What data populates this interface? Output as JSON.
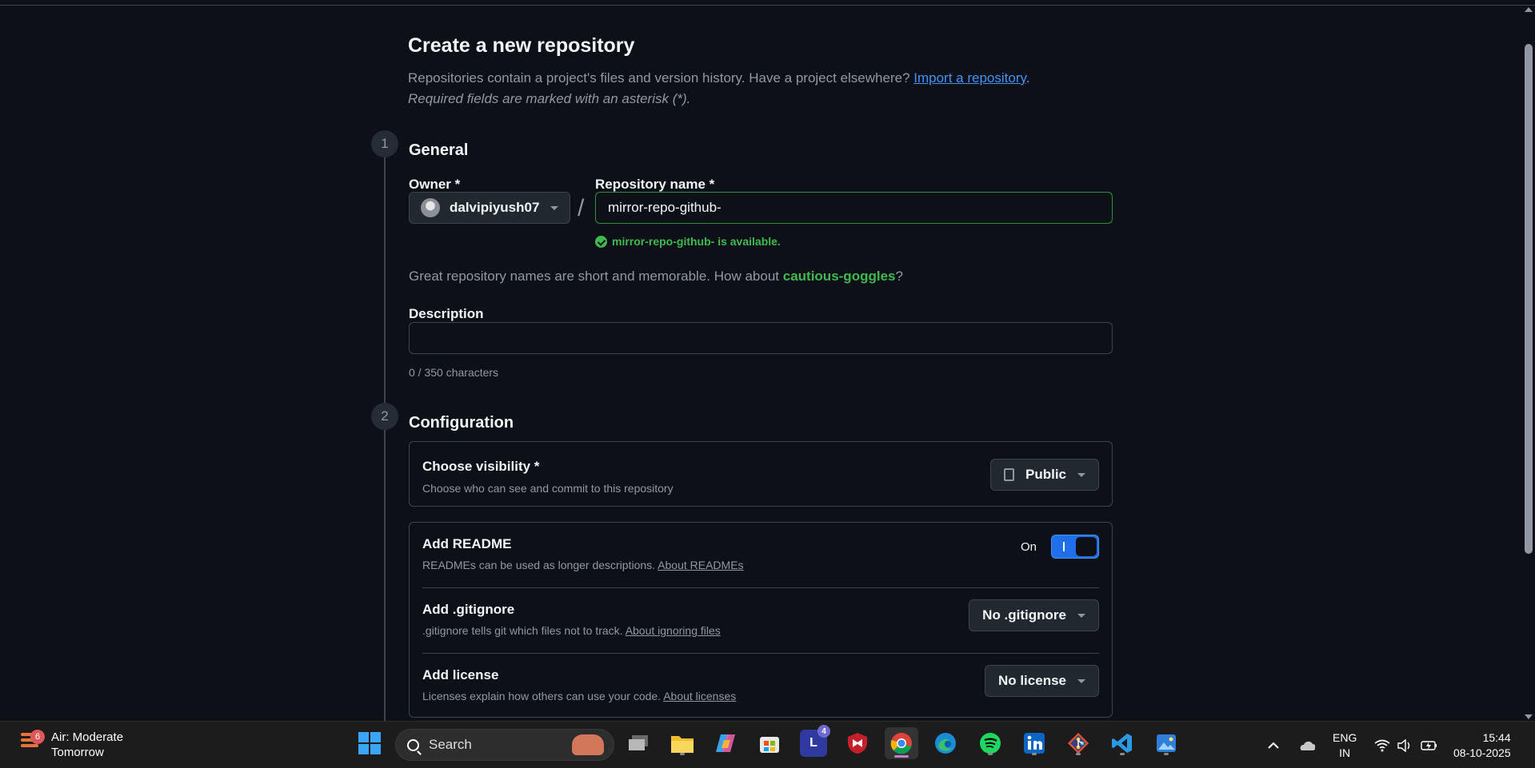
{
  "page": {
    "title": "Create a new repository",
    "subtitle": "Repositories contain a project's files and version history. Have a project elsewhere?",
    "import_link": "Import a repository",
    "subtitle_end": ".",
    "required_note": "Required fields are marked with an asterisk (*)."
  },
  "general": {
    "step": "1",
    "title": "General",
    "owner_label": "Owner *",
    "owner_value": "dalvipiyush07",
    "slash": "/",
    "repo_label": "Repository name *",
    "repo_value": "mirror-repo-github-",
    "availability": "mirror-repo-github- is available.",
    "suggest_prefix": "Great repository names are short and memorable. How about",
    "suggest_name": "cautious-goggles",
    "suggest_suffix": "?",
    "description_label": "Description",
    "description_value": "",
    "char_count": "0 / 350 characters"
  },
  "configuration": {
    "step": "2",
    "title": "Configuration",
    "visibility": {
      "title": "Choose visibility *",
      "desc": "Choose who can see and commit to this repository",
      "value": "Public"
    },
    "readme": {
      "title": "Add README",
      "desc": "READMEs can be used as longer descriptions.",
      "link": "About READMEs",
      "toggle_label": "On",
      "toggle_on": true
    },
    "gitignore": {
      "title": "Add .gitignore",
      "desc": ".gitignore tells git which files not to track.",
      "link": "About ignoring files",
      "value": "No .gitignore"
    },
    "license": {
      "title": "Add license",
      "desc": "Licenses explain how others can use your code.",
      "link": "About licenses",
      "value": "No license"
    }
  },
  "taskbar": {
    "weather_badge": "6",
    "weather_line1": "Air: Moderate",
    "weather_line2": "Tomorrow",
    "search_label": "Search",
    "app_badge": "4",
    "lang_line1": "ENG",
    "lang_line2": "IN",
    "time": "15:44",
    "date": "08-10-2025",
    "icons": [
      "windows-start-icon",
      "task-view-icon",
      "file-explorer-icon",
      "copilot-icon",
      "microsoft-store-icon",
      "l-app-icon",
      "mcafee-icon",
      "chrome-icon",
      "edge-icon",
      "spotify-icon",
      "linkedin-icon",
      "git-icon",
      "vscode-icon",
      "photos-icon"
    ]
  },
  "colors": {
    "background": "#0d1117",
    "accent_green": "#3fb950",
    "link_blue": "#4493f8",
    "toggle_blue": "#1f6feb"
  }
}
